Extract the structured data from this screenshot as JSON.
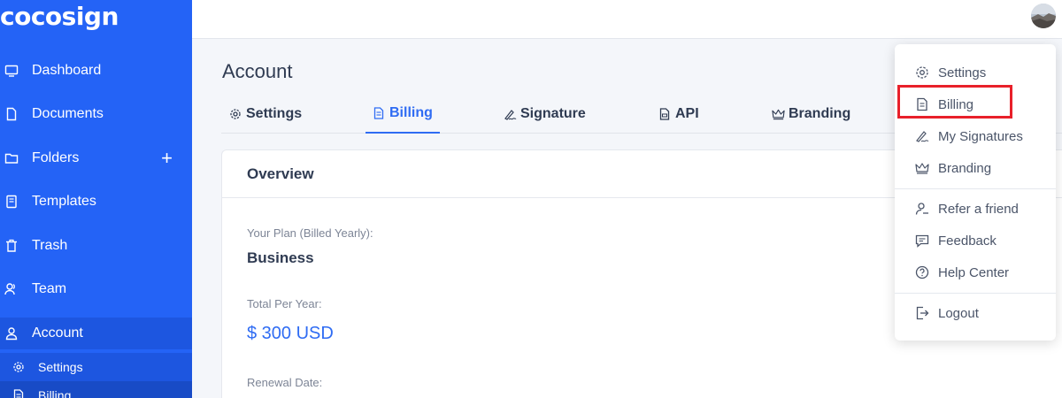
{
  "brand": {
    "logo_text": "cocosign",
    "accent": "#2463f6"
  },
  "sidebar": {
    "items": [
      {
        "label": "Dashboard",
        "icon": "monitor-icon"
      },
      {
        "label": "Documents",
        "icon": "document-icon"
      },
      {
        "label": "Folders",
        "icon": "folder-icon",
        "action": "+"
      },
      {
        "label": "Templates",
        "icon": "template-icon"
      },
      {
        "label": "Trash",
        "icon": "trash-icon"
      },
      {
        "label": "Team",
        "icon": "team-icon"
      },
      {
        "label": "Account",
        "icon": "user-icon"
      }
    ],
    "sub_items": [
      {
        "label": "Settings",
        "icon": "gear-icon"
      },
      {
        "label": "Billing",
        "icon": "billing-icon"
      }
    ]
  },
  "main": {
    "title": "Account",
    "tabs": [
      {
        "label": "Settings",
        "icon": "gear-icon"
      },
      {
        "label": "Billing",
        "icon": "billing-icon"
      },
      {
        "label": "Signature",
        "icon": "signature-icon"
      },
      {
        "label": "API",
        "icon": "api-icon"
      },
      {
        "label": "Branding",
        "icon": "crown-icon"
      }
    ],
    "overview": {
      "header": "Overview",
      "plan_label": "Your Plan (Billed Yearly):",
      "plan_value": "Business",
      "total_label": "Total Per Year:",
      "total_value": "$ 300 USD",
      "renewal_label": "Renewal Date:"
    }
  },
  "dropdown": {
    "items": [
      {
        "label": "Settings",
        "icon": "gear-icon"
      },
      {
        "label": "Billing",
        "icon": "billing-icon"
      },
      {
        "label": "My Signatures",
        "icon": "signature-icon"
      },
      {
        "label": "Branding",
        "icon": "crown-icon"
      },
      {
        "label": "Refer a friend",
        "icon": "refer-icon"
      },
      {
        "label": "Feedback",
        "icon": "feedback-icon"
      },
      {
        "label": "Help Center",
        "icon": "help-icon"
      },
      {
        "label": "Logout",
        "icon": "logout-icon"
      }
    ],
    "highlight_color": "#e8202a"
  }
}
